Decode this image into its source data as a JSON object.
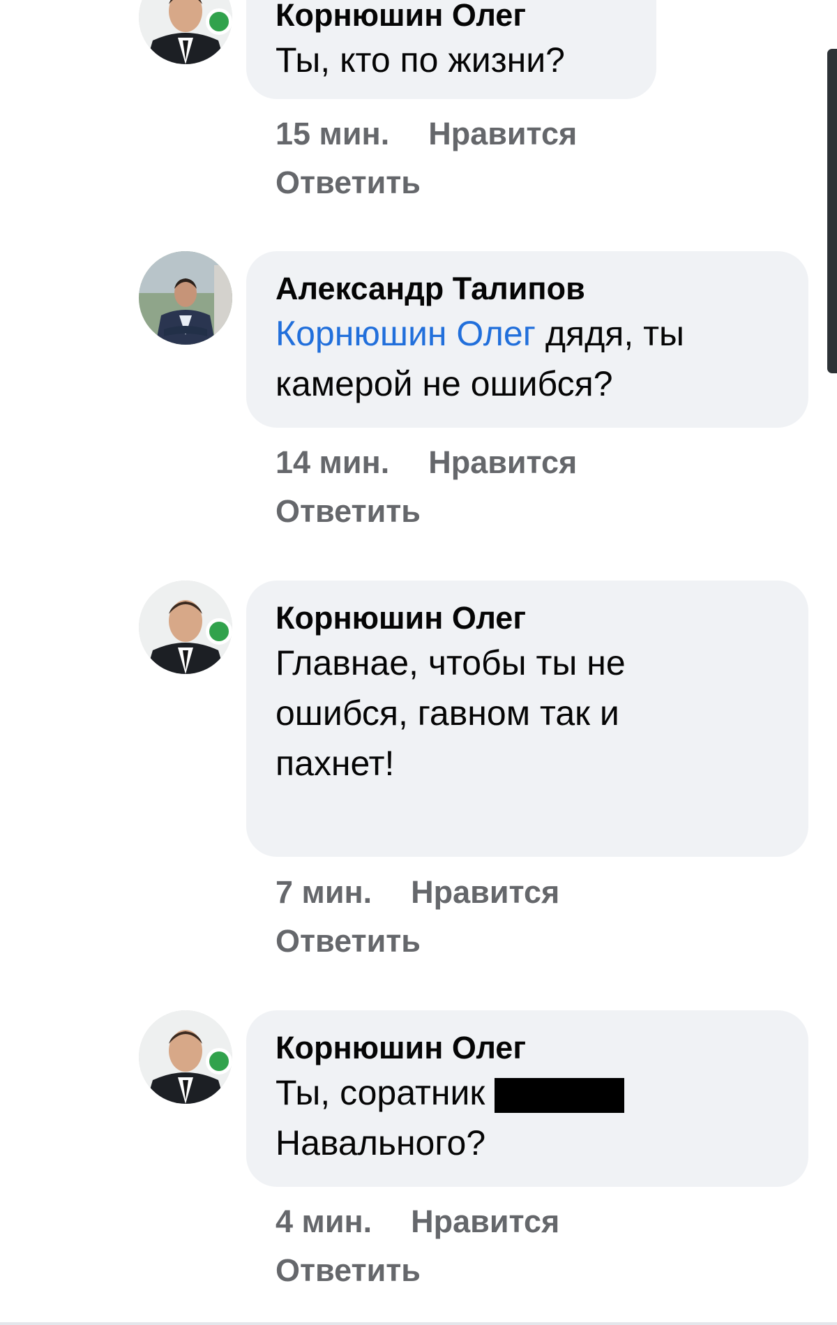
{
  "comments": [
    {
      "author": "Корнюшин Олег",
      "text": "Ты, кто по жизни?",
      "time": "15 мин.",
      "like": "Нравится",
      "reply": "Ответить"
    },
    {
      "author": "Александр Талипов",
      "mention": "Корнюшин Олег",
      "text": " дядя, ты камерой не ошибся?",
      "time": "14 мин.",
      "like": "Нравится",
      "reply": "Ответить"
    },
    {
      "author": "Корнюшин Олег",
      "text": "Главнае, чтобы ты не ошибся, гавном так и пахнет!",
      "time": "7 мин.",
      "like": "Нравится",
      "reply": "Ответить"
    },
    {
      "author": "Корнюшин Олег",
      "text_before": "Ты, соратник ",
      "text_after": "Навального?",
      "time": "4 мин.",
      "like": "Нравится",
      "reply": "Ответить"
    }
  ],
  "colors": {
    "bubble": "#f0f2f5",
    "mention": "#216fdb",
    "meta": "#65676b",
    "online": "#31a24c"
  }
}
